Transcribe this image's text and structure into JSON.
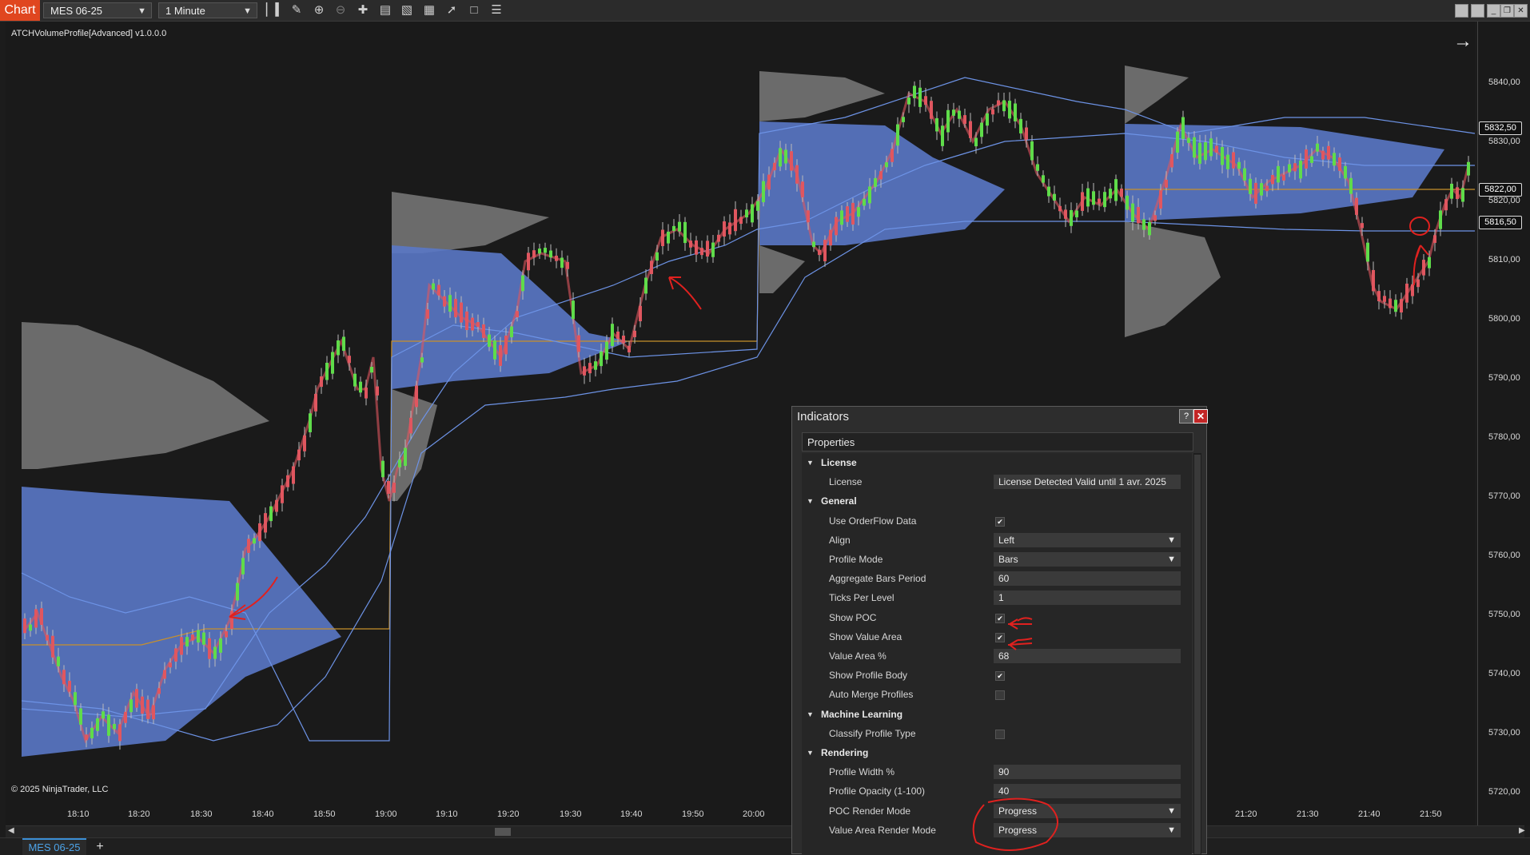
{
  "toolbar": {
    "chart_tab": "Chart",
    "instrument": "MES 06-25",
    "interval": "1 Minute",
    "icons": [
      "bar-type-icon",
      "pencil-icon",
      "zoom-in-icon",
      "zoom-out-icon",
      "crosshair-icon",
      "properties-icon",
      "templates-icon",
      "data-box-icon",
      "strategies-icon",
      "indicators-icon",
      "list-icon"
    ]
  },
  "chart": {
    "indicator_label": "ATCHVolumeProfile[Advanced] v1.0.0.0",
    "copyright": "© 2025 NinjaTrader, LLC",
    "price_labels": [
      "5840,00",
      "5830,00",
      "5820,00",
      "5810,00",
      "5800,00",
      "5790,00",
      "5780,00",
      "5770,00",
      "5760,00",
      "5750,00",
      "5740,00",
      "5730,00",
      "5720,00"
    ],
    "price_boxes": [
      "5832,50",
      "5822,00",
      "5816,50"
    ],
    "time_labels": [
      "18:10",
      "18:20",
      "18:30",
      "18:40",
      "18:50",
      "19:00",
      "19:10",
      "19:20",
      "19:30",
      "19:40",
      "19:50",
      "20:00",
      "21:20",
      "21:30",
      "21:40",
      "21:50"
    ],
    "colors": {
      "bull": "#5fdc4a",
      "bear": "#e0565f",
      "profile": "#7f7f7f",
      "value_area": "#5a78c6",
      "line": "#6d93e6",
      "poc": "#c8902b"
    }
  },
  "bottom_tabs": {
    "instrument_tab": "MES 06-25",
    "add_tab": "+"
  },
  "dialog": {
    "title": "Indicators",
    "help": "?",
    "close": "✕",
    "section_header": "Properties",
    "rows": [
      {
        "type": "cat",
        "label": "License"
      },
      {
        "type": "text",
        "label": "License",
        "value": "License Detected Valid until 1 avr. 2025"
      },
      {
        "type": "cat",
        "label": "General"
      },
      {
        "type": "check",
        "label": "Use OrderFlow Data",
        "value": "✔"
      },
      {
        "type": "select",
        "label": "Align",
        "value": "Left"
      },
      {
        "type": "select",
        "label": "Profile Mode",
        "value": "Bars"
      },
      {
        "type": "text",
        "label": "Aggregate Bars Period",
        "value": "60"
      },
      {
        "type": "text",
        "label": "Ticks Per Level",
        "value": "1"
      },
      {
        "type": "check",
        "label": "Show POC",
        "value": "✔"
      },
      {
        "type": "check",
        "label": "Show Value Area",
        "value": "✔"
      },
      {
        "type": "text",
        "label": "Value Area %",
        "value": "68"
      },
      {
        "type": "check",
        "label": "Show Profile Body",
        "value": "✔"
      },
      {
        "type": "check",
        "label": "Auto Merge Profiles",
        "value": ""
      },
      {
        "type": "cat",
        "label": "Machine Learning"
      },
      {
        "type": "check",
        "label": "Classify Profile Type",
        "value": ""
      },
      {
        "type": "cat",
        "label": "Rendering"
      },
      {
        "type": "text",
        "label": "Profile Width %",
        "value": "90"
      },
      {
        "type": "text",
        "label": "Profile Opacity (1-100)",
        "value": "40"
      },
      {
        "type": "select",
        "label": "POC Render Mode",
        "value": "Progress"
      },
      {
        "type": "select",
        "label": "Value Area Render Mode",
        "value": "Progress"
      }
    ]
  }
}
